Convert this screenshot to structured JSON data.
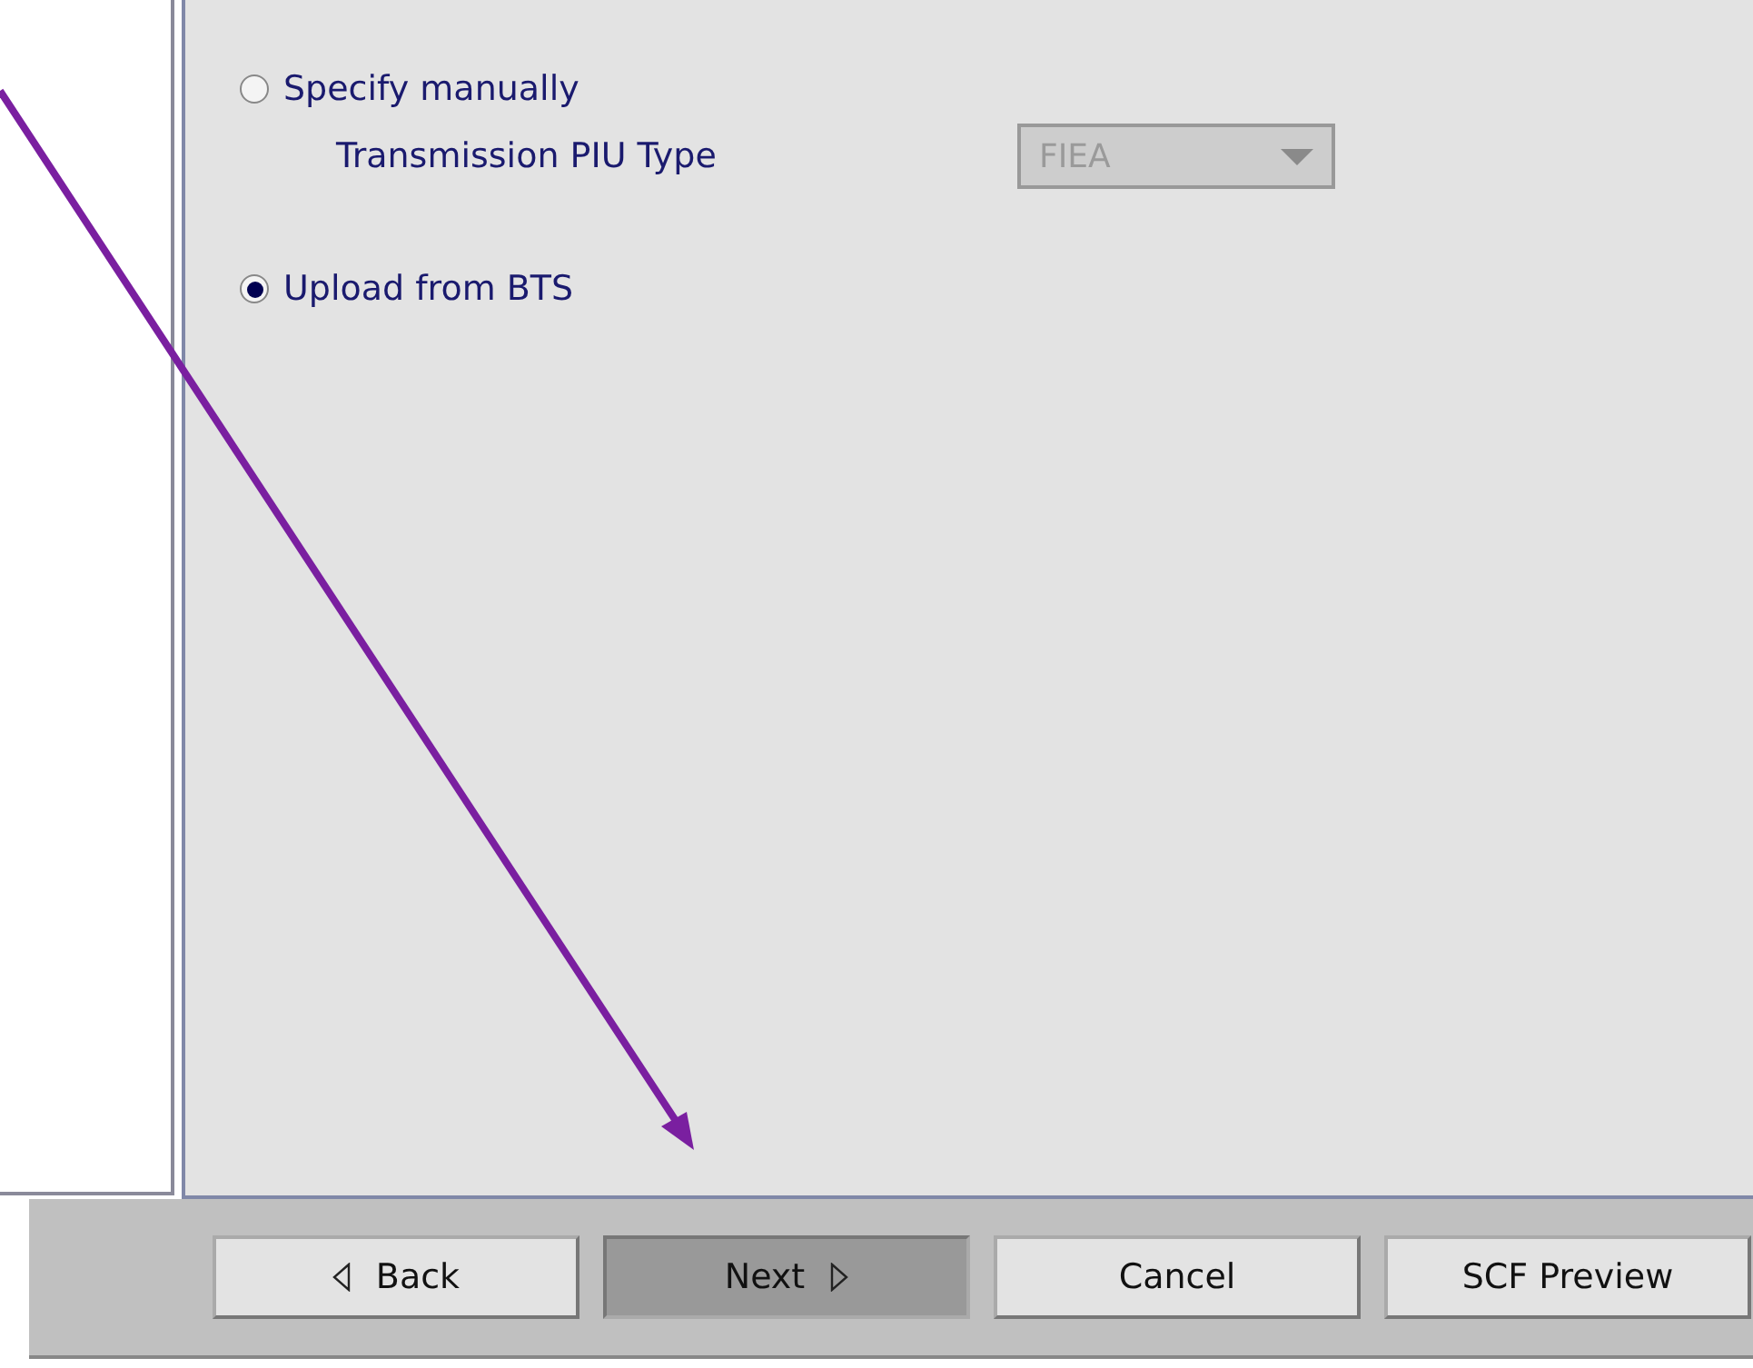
{
  "options": [
    {
      "label": "Specify manually",
      "selected": false
    },
    {
      "label": "Upload from BTS",
      "selected": true
    }
  ],
  "piu_type": {
    "label": "Transmission PIU Type",
    "value": "FIEA",
    "disabled": true
  },
  "buttons": [
    {
      "label": "Back",
      "kind": "back",
      "pressed": false
    },
    {
      "label": "Next",
      "kind": "next",
      "pressed": true
    },
    {
      "label": "Cancel",
      "kind": "plain",
      "pressed": false
    },
    {
      "label": "SCF Preview",
      "kind": "plain",
      "pressed": false
    }
  ]
}
